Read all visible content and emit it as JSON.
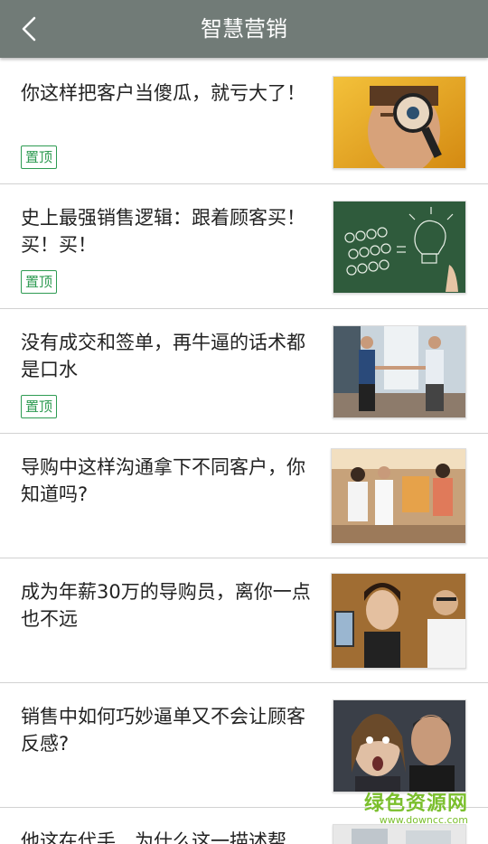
{
  "header": {
    "title": "智慧营销",
    "back_icon": "chevron-left-icon"
  },
  "articles": [
    {
      "title": "你这样把客户当傻瓜，就亏大了！",
      "tag": "置顶",
      "image": "magnifier-eye-photo"
    },
    {
      "title": "史上最强销售逻辑：跟着顾客买！买！买！",
      "tag": "置顶",
      "image": "chalkboard-lightbulb-photo"
    },
    {
      "title": "没有成交和签单，再牛逼的话术都是口水",
      "tag": "置顶",
      "image": "business-handshake-photo"
    },
    {
      "title": "导购中这样沟通拿下不同客户，你知道吗?",
      "image": "store-shoppers-photo"
    },
    {
      "title": "成为年薪30万的导购员，离你一点也不远",
      "image": "saleswoman-phone-photo"
    },
    {
      "title": "销售中如何巧妙逼单又不会让顾客反感?",
      "image": "whisper-surprise-photo"
    },
    {
      "title": "他这在代手…为什么这一描述帮",
      "image": "partial-photo"
    }
  ],
  "watermark": {
    "name": "绿色资源网",
    "url": "www.downcc.com"
  }
}
